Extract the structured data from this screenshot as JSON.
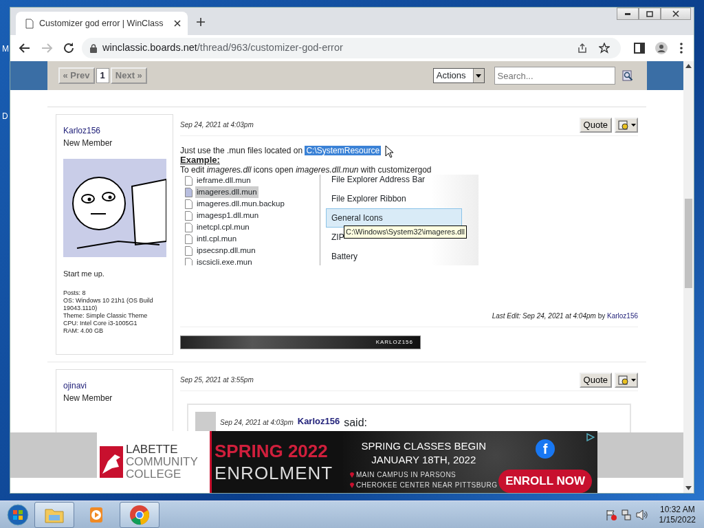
{
  "desktop_labels": [
    "M",
    "D"
  ],
  "browser": {
    "tab": {
      "title": "Customizer god error | WinClass",
      "selected": true
    },
    "address": {
      "domain": "winclassic.boards.net",
      "path": "/thread/963/customizer-god-error"
    }
  },
  "toolbar": {
    "pagination": [
      {
        "label": "« Prev",
        "selected": false
      },
      {
        "label": "1",
        "selected": true
      },
      {
        "label": "Next »",
        "selected": false
      }
    ],
    "actions": "Actions",
    "search": {
      "placeholder": "Search..."
    }
  },
  "posts": [
    {
      "author": "Karloz156",
      "rank": "New Member",
      "status": "Start me up.",
      "stats": [
        "Posts: 8",
        "OS: Windows 10 21h1 (OS Build 19043.1110)",
        "Theme: Simple Classic Theme",
        "CPU: Intel Core i3-1005G1",
        "RAM: 4.00 GB"
      ],
      "date": "Sep 24, 2021 at 4:03pm",
      "quote_button": "Quote",
      "intro": "Just use the .mun files located on",
      "highlight": "C:\\SystemResource",
      "heading": "Example:",
      "line": "To edit *imageres.dll* icons open *imageres.dll.mun* with customizergod",
      "screenshot": {
        "files": [
          {
            "name": "ieframe.dll.mun",
            "selected": false
          },
          {
            "name": "imageres.dll.mun",
            "selected": true
          },
          {
            "name": "imageres.dll.mun.backup",
            "selected": false
          },
          {
            "name": "imagesp1.dll.mun",
            "selected": false
          },
          {
            "name": "inetcpl.cpl.mun",
            "selected": false
          },
          {
            "name": "intl.cpl.mun",
            "selected": false
          },
          {
            "name": "ipsecsnp.dll.mun",
            "selected": false
          },
          {
            "name": "iscsicli.exe.mun",
            "selected": false
          }
        ],
        "groups": [
          {
            "label": "File Explorer Address Bar",
            "selected": false
          },
          {
            "label": "File Explorer Ribbon",
            "selected": false
          },
          {
            "label": "General Icons",
            "selected": true
          },
          {
            "label": "ZIP",
            "selected": false
          },
          {
            "label": "Battery",
            "selected": false
          }
        ],
        "tooltip": "C:\\Windows\\System32\\imageres.dll"
      },
      "last_edit": "Last Edit: Sep 24, 2021 at 4:04pm",
      "last_edit_by": "by",
      "editor": "Karloz156",
      "signature": "KARLOZ156"
    },
    {
      "author": "ojinavi",
      "rank": "New Member",
      "date": "Sep 25, 2021 at 3:55pm",
      "quote_button": "Quote",
      "quote": {
        "date": "Sep 24, 2021 at 4:03pm",
        "author": "Karloz156",
        "said": "said:"
      }
    }
  ],
  "ad": {
    "brand": [
      "LABETTE",
      "COMMUNITY",
      "COLLEGE"
    ],
    "headline": "SPRING 2022",
    "subline": "ENROLMENT",
    "announce": [
      "SPRING CLASSES BEGIN",
      "JANUARY 18TH, 2022"
    ],
    "locations": [
      "MAIN CAMPUS IN PARSONS",
      "CHEROKEE CENTER NEAR PITTSBURG"
    ],
    "social": "f",
    "cta": "ENROLL NOW"
  },
  "taskbar": {
    "apps": [
      {
        "kind": "folder",
        "running": true
      },
      {
        "kind": "media",
        "running": false
      },
      {
        "kind": "chrome",
        "running": true
      }
    ],
    "time": "10:32 AM",
    "date": "1/15/2022"
  }
}
